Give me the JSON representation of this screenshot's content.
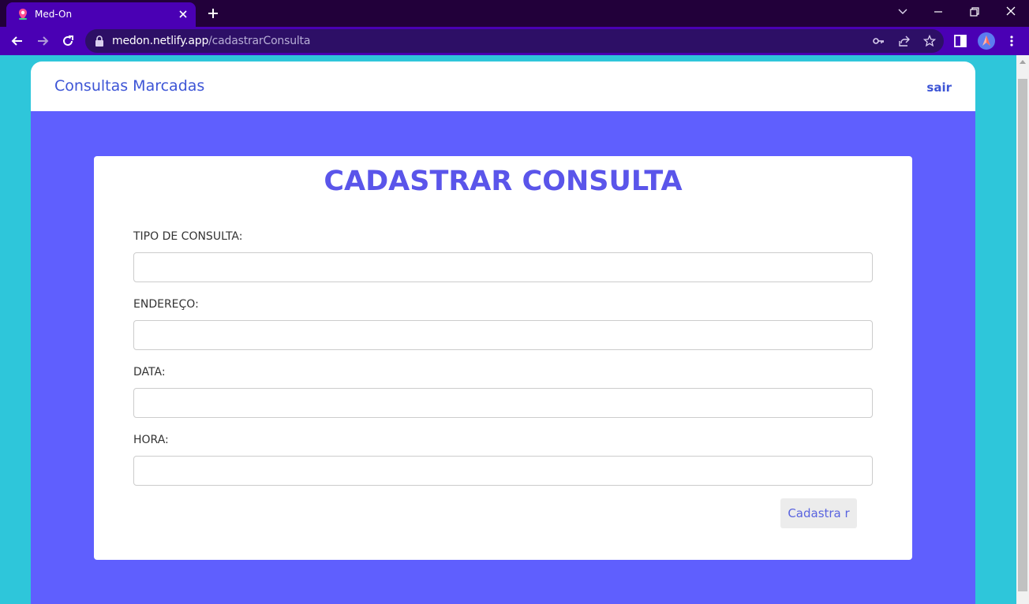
{
  "browser": {
    "tab_title": "Med-On",
    "url_host": "medon.netlify.app",
    "url_path": "/cadastrarConsulta"
  },
  "navbar": {
    "link": "Consultas Marcadas",
    "logout": "sair"
  },
  "form": {
    "title": "CADASTRAR CONSULTA",
    "fields": [
      {
        "label": "TIPO DE CONSULTA:",
        "value": ""
      },
      {
        "label": "ENDEREÇO:",
        "value": ""
      },
      {
        "label": "DATA:",
        "value": ""
      },
      {
        "label": "HORA:",
        "value": ""
      }
    ],
    "submit": "Cadastra r"
  },
  "colors": {
    "page_background": "#2ec6da",
    "panel": "#5f5ffe",
    "title": "#5a55ea",
    "link": "#3d55d6",
    "browser_frame": "#22003a",
    "browser_toolbar": "#4a00b4"
  },
  "icons": [
    "map-pin-favicon-icon",
    "close-icon",
    "plus-icon",
    "chevron-down-icon",
    "minimize-icon",
    "restore-icon",
    "close-window-icon",
    "back-arrow-icon",
    "forward-arrow-icon",
    "reload-icon",
    "lock-icon",
    "key-icon",
    "share-icon",
    "star-icon",
    "side-panel-icon",
    "profile-avatar-icon",
    "more-vert-icon"
  ]
}
